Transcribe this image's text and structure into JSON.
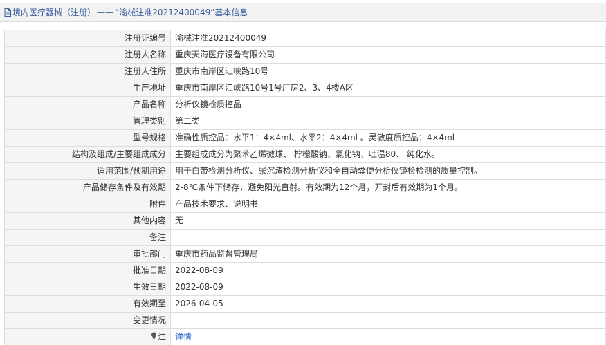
{
  "header": {
    "category": "境内医疗器械（注册）",
    "separator": "——",
    "title": "“渝械注准20212400049”基本信息"
  },
  "fields": [
    {
      "label": "注册证编号",
      "value": "渝械注准20212400049"
    },
    {
      "label": "注册人名称",
      "value": "重庆天海医疗设备有限公司"
    },
    {
      "label": "注册人住所",
      "value": "重庆市南岸区江峡路10号"
    },
    {
      "label": "生产地址",
      "value": "重庆市南岸区江峡路10号1号厂房2、3、4楼A区"
    },
    {
      "label": "产品名称",
      "value": "分析仪镜检质控品"
    },
    {
      "label": "管理类别",
      "value": "第二类"
    },
    {
      "label": "型号规格",
      "value": "准确性质控品：水平1：4×4ml、水平2：4×4ml 。灵敏度质控品：4×4ml"
    },
    {
      "label": "结构及组成/主要组成成分",
      "value": "主要组成成分为聚苯乙烯微球、 柠檬酸钠、氯化钠、吐温80、 纯化水。"
    },
    {
      "label": "适用范围/预期用途",
      "value": "用于白带检测分析仪、尿沉渣检测分析仪和全自动粪便分析仪镜检检测的质量控制。"
    },
    {
      "label": "产品储存条件及有效期",
      "value": "2-8℃条件下储存，避免阳光直射。有效期为12个月，开封后有效期为1个月。"
    },
    {
      "label": "附件",
      "value": "产品技术要求、说明书"
    },
    {
      "label": "其他内容",
      "value": "无"
    },
    {
      "label": "备注",
      "value": ""
    },
    {
      "label": "审批部门",
      "value": "重庆市药品监督管理局"
    },
    {
      "label": "批准日期",
      "value": "2022-08-09"
    },
    {
      "label": "生效日期",
      "value": "2022-08-09"
    },
    {
      "label": "有效期至",
      "value": "2026-04-05"
    },
    {
      "label": "变更情况",
      "value": ""
    }
  ],
  "note": {
    "label": "注",
    "link": "详情",
    "icon": "lightbulb-icon"
  },
  "colors": {
    "link": "#2a62c9",
    "title": "#3a5d9c",
    "label_bg": "#f5f5f5",
    "border": "#dddddd"
  }
}
